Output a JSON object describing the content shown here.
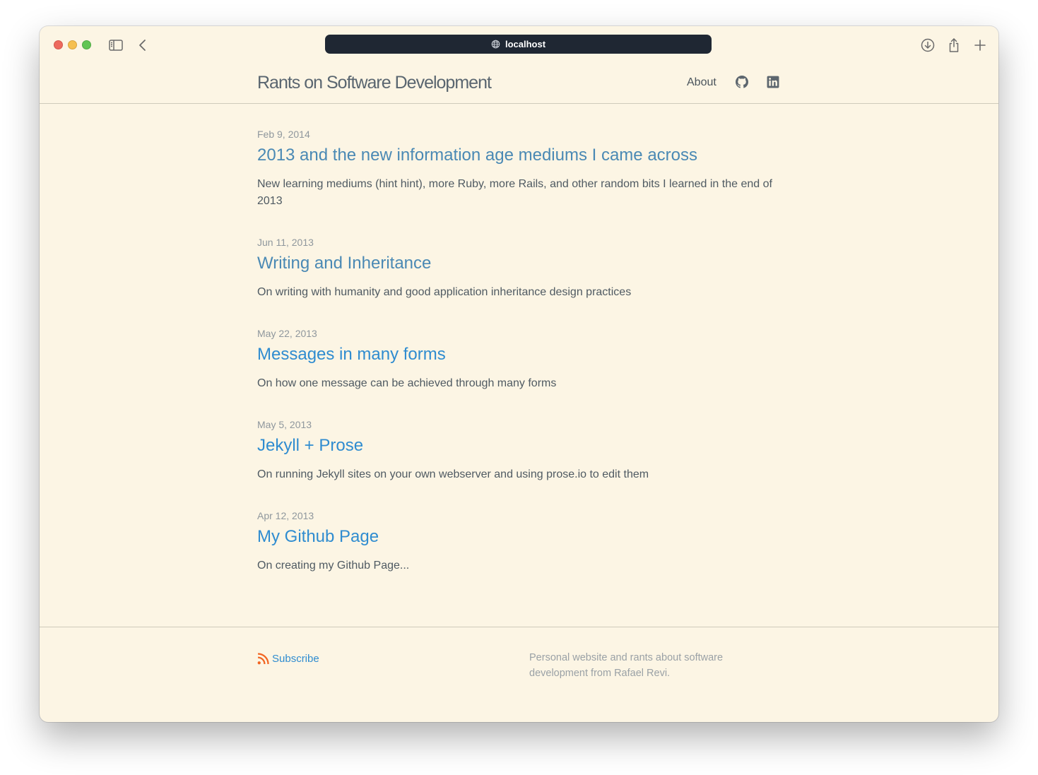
{
  "browser": {
    "url": "localhost",
    "icons": [
      "sidebar-icon",
      "back-chevron-icon",
      "download-icon",
      "share-icon",
      "new-tab-plus-icon",
      "globe-icon"
    ]
  },
  "site": {
    "title": "Rants on Software Development",
    "nav": {
      "about": "About",
      "icons": [
        "github-icon",
        "linkedin-icon"
      ]
    }
  },
  "posts": [
    {
      "date": "Feb 9, 2014",
      "title": "2013 and the new information age mediums I came across",
      "excerpt": "New learning mediums (hint hint), more Ruby, more Rails, and other random bits I learned in the end of 2013"
    },
    {
      "date": "Jun 11, 2013",
      "title": "Writing and Inheritance",
      "excerpt": "On writing with humanity and good application inheritance design practices"
    },
    {
      "date": "May 22, 2013",
      "title": "Messages in many forms",
      "excerpt": "On how one message can be achieved through many forms"
    },
    {
      "date": "May 5, 2013",
      "title": "Jekyll + Prose",
      "excerpt": "On running Jekyll sites on your own webserver and using prose.io to edit them"
    },
    {
      "date": "Apr 12, 2013",
      "title": "My Github Page",
      "excerpt": "On creating my Github Page..."
    }
  ],
  "footer": {
    "subscribe": "Subscribe",
    "description": "Personal website and rants about software development from Rafael Revi."
  },
  "colors": {
    "page_bg": "#fcf5e4",
    "link": "#2f8cd0",
    "rss": "#f26522",
    "urlbar_bg": "#1f2733"
  }
}
